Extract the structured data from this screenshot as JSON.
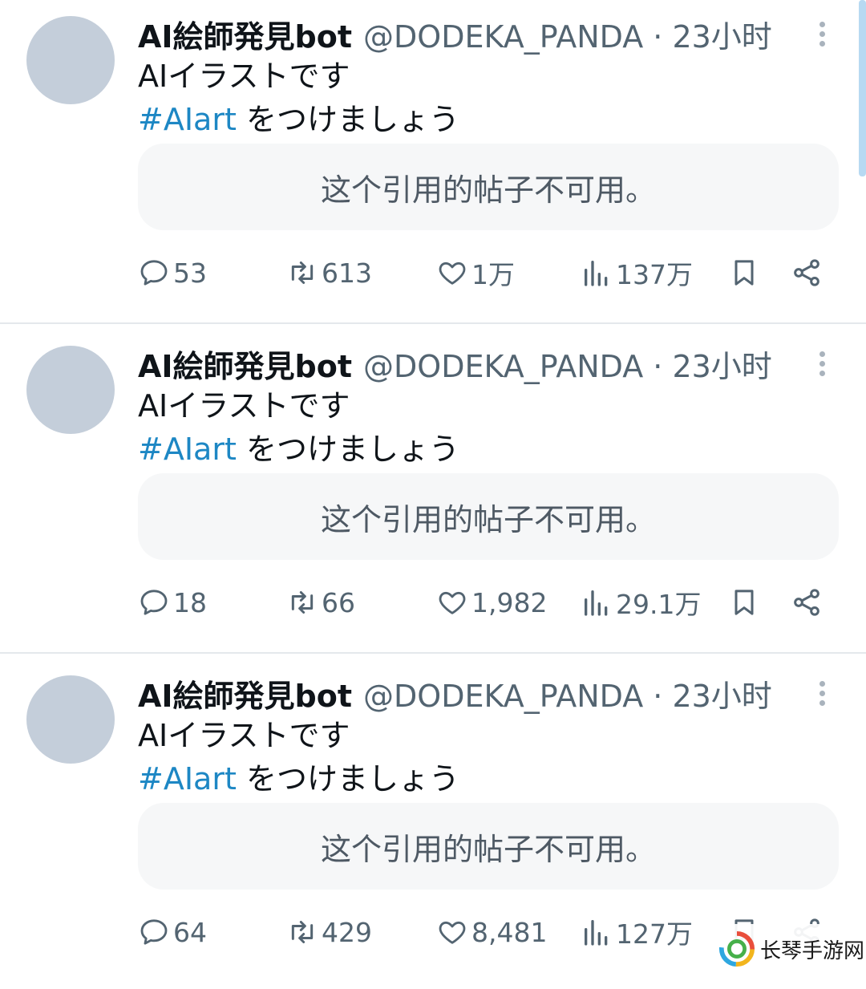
{
  "tweets": [
    {
      "name": "AI絵師発見bot",
      "handle": "@DODEKA_PANDA · 23小时",
      "text_line1": "AIイラストです",
      "hashtag": "#AIart",
      "text_line2_rest": " をつけましょう",
      "quote_unavailable": "这个引用的帖子不可用。",
      "replies": "53",
      "reposts": "613",
      "likes": "1万",
      "views": "137万"
    },
    {
      "name": "AI絵師発見bot",
      "handle": "@DODEKA_PANDA · 23小时",
      "text_line1": "AIイラストです",
      "hashtag": "#AIart",
      "text_line2_rest": " をつけましょう",
      "quote_unavailable": "这个引用的帖子不可用。",
      "replies": "18",
      "reposts": "66",
      "likes": "1,982",
      "views": "29.1万"
    },
    {
      "name": "AI絵師発見bot",
      "handle": "@DODEKA_PANDA · 23小时",
      "text_line1": "AIイラストです",
      "hashtag": "#AIart",
      "text_line2_rest": " をつけましょう",
      "quote_unavailable": "这个引用的帖子不可用。",
      "replies": "64",
      "reposts": "429",
      "likes": "8,481",
      "views": "127万"
    }
  ],
  "watermark": {
    "text": "长琴手游网"
  },
  "colors": {
    "hashtag": "#1d87c4",
    "icon": "#536471",
    "avatar": "#c4ceda",
    "quote_bg": "#f6f7f8"
  },
  "icons": [
    "reply-icon",
    "repost-icon",
    "like-icon",
    "views-icon",
    "bookmark-icon",
    "share-icon",
    "more-icon"
  ]
}
